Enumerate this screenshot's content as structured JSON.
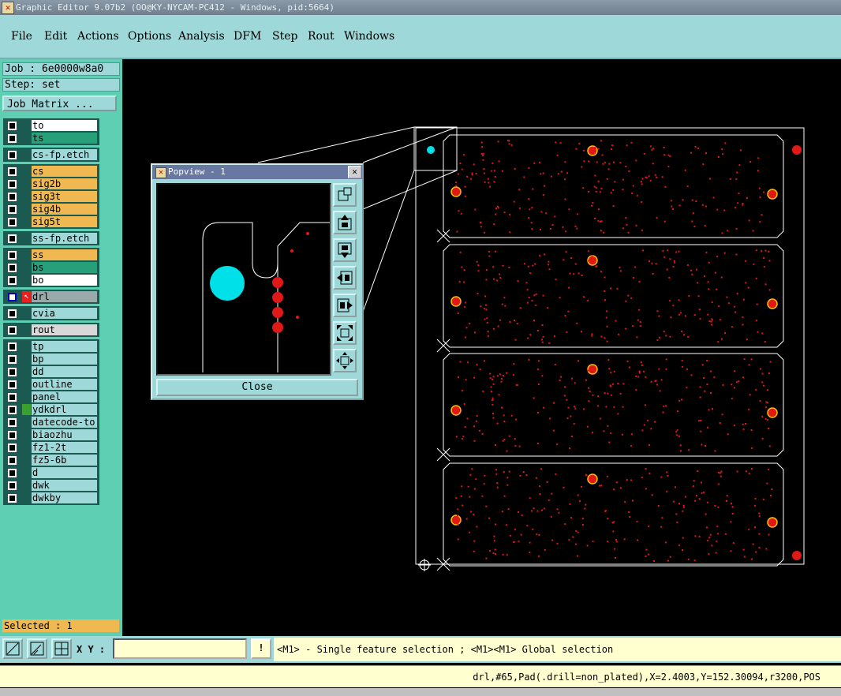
{
  "window": {
    "title": "Graphic Editor 9.07b2  (OO@KY-NYCAM-PC412 - Windows, pid:5664)"
  },
  "menu": [
    "File",
    "Edit",
    "Actions",
    "Options",
    "Analysis",
    "DFM",
    "Step",
    "Rout",
    "Windows"
  ],
  "job": {
    "label": "Job : 6e0000w8a0",
    "step": "Step: set",
    "matrix_button": "Job Matrix ..."
  },
  "layers": [
    {
      "name": "to",
      "color": "#ffffff"
    },
    {
      "name": "ts",
      "color": "#27a07a"
    },
    {
      "name": "cs-fp.etch",
      "color": "#9fd8d8"
    },
    {
      "name": "cs",
      "color": "#f0b850"
    },
    {
      "name": "sig2b",
      "color": "#f0b850"
    },
    {
      "name": "sig3t",
      "color": "#f0b850"
    },
    {
      "name": "sig4b",
      "color": "#f0b850"
    },
    {
      "name": "sig5t",
      "color": "#f0b850"
    },
    {
      "name": "ss-fp.etch",
      "color": "#9fd8d8"
    },
    {
      "name": "ss",
      "color": "#f0b850"
    },
    {
      "name": "bs",
      "color": "#27a07a"
    },
    {
      "name": "bo",
      "color": "#ffffff"
    },
    {
      "name": "drl",
      "color": "#9aaaaa"
    },
    {
      "name": "cvia",
      "color": "#9fd8d8"
    },
    {
      "name": "rout",
      "color": "#d8d8d8"
    },
    {
      "name": "tp",
      "color": "#9fd8d8"
    },
    {
      "name": "bp",
      "color": "#9fd8d8"
    },
    {
      "name": "dd",
      "color": "#9fd8d8"
    },
    {
      "name": "outline",
      "color": "#9fd8d8"
    },
    {
      "name": "panel",
      "color": "#9fd8d8"
    },
    {
      "name": "ydkdrl",
      "color": "#9fd8d8"
    },
    {
      "name": "datecode-to",
      "color": "#9fd8d8"
    },
    {
      "name": "biaozhu",
      "color": "#9fd8d8"
    },
    {
      "name": "fz1-2t",
      "color": "#9fd8d8"
    },
    {
      "name": "fz5-6b",
      "color": "#9fd8d8"
    },
    {
      "name": "d",
      "color": "#9fd8d8"
    },
    {
      "name": "dwk",
      "color": "#9fd8d8"
    },
    {
      "name": "dwkby",
      "color": "#9fd8d8"
    }
  ],
  "selected": "Selected : 1",
  "xy_label": "X Y :",
  "xy_value": "",
  "hint": "<M1> - Single feature selection ; <M1><M1> Global selection",
  "status": "drl,#65,Pad(.drill=non_plated),X=2.4003,Y=152.30094,r3200,POS",
  "popview": {
    "title": "Popview - 1",
    "close_label": "Close"
  },
  "icons": {
    "app": "app-icon",
    "popview_buttons": [
      "zoom-window-icon",
      "pan-up-icon",
      "pan-down-icon",
      "pan-left-icon",
      "pan-right-icon",
      "zoom-fit-icon",
      "zoom-home-icon"
    ],
    "toolbar": [
      "measure-icon",
      "snap-icon",
      "grid-icon",
      "alert-icon"
    ]
  },
  "colors": {
    "accent": "#9fd8d8",
    "drill": "#e01818",
    "selected_pad": "#00e0e8",
    "outline": "#ffffff",
    "yellow_panel": "#ffffd0"
  }
}
